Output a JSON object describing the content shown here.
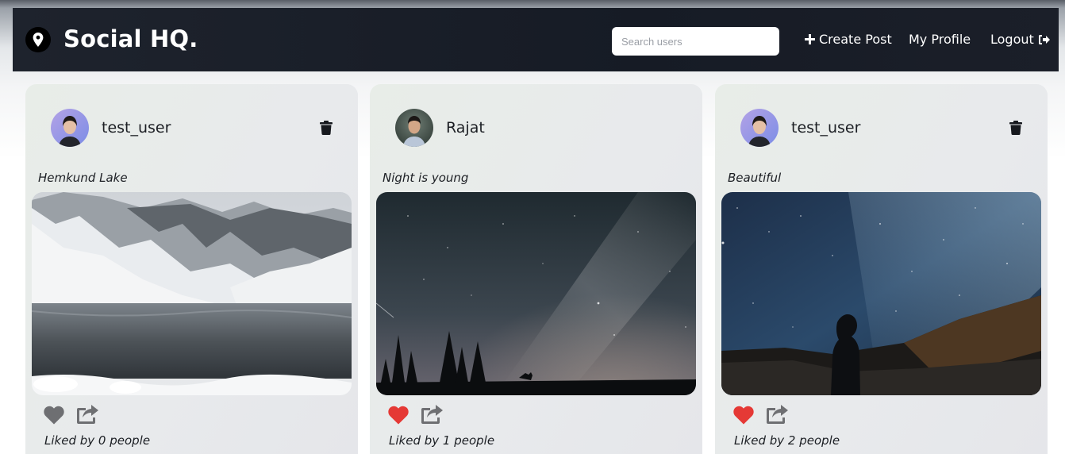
{
  "app": {
    "brand": "Social HQ.",
    "brand_icon": "map-pin-icon"
  },
  "nav": {
    "search_placeholder": "Search users",
    "create_post": "Create Post",
    "my_profile": "My Profile",
    "logout": "Logout"
  },
  "colors": {
    "navbar": "#161b25",
    "liked": "#e53935",
    "unliked": "#6e6f72",
    "card": "#e8ebea"
  },
  "posts": [
    {
      "username": "test_user",
      "caption": "Hemkund Lake",
      "likes_text": "Liked by 0 people",
      "liked": false,
      "can_delete": true
    },
    {
      "username": "Rajat",
      "caption": "Night is young",
      "likes_text": "Liked by 1 people",
      "liked": true,
      "can_delete": false
    },
    {
      "username": "test_user",
      "caption": "Beautiful",
      "likes_text": "Liked by 2 people",
      "liked": true,
      "can_delete": true
    }
  ]
}
